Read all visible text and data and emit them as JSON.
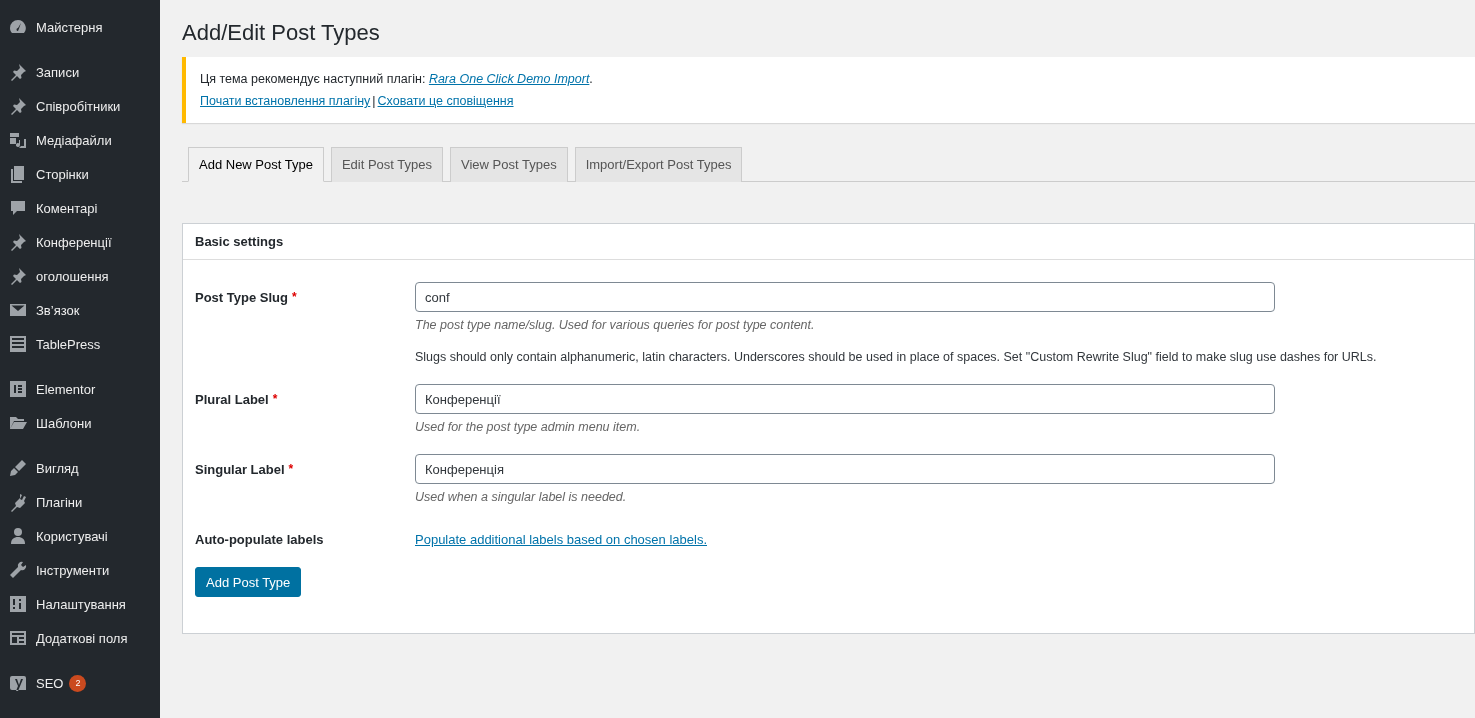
{
  "sidebar": {
    "groups": [
      {
        "items": [
          {
            "label": "Майстерня",
            "kind": "gauge"
          }
        ]
      },
      {
        "items": [
          {
            "label": "Записи",
            "kind": "pin"
          },
          {
            "label": "Співробітники",
            "kind": "pin"
          },
          {
            "label": "Медіафайли",
            "kind": "media"
          },
          {
            "label": "Сторінки",
            "kind": "pages"
          },
          {
            "label": "Коментарі",
            "kind": "comment"
          },
          {
            "label": "Конференції",
            "kind": "pin"
          },
          {
            "label": "оголошення",
            "kind": "pin"
          },
          {
            "label": "Зв’язок",
            "kind": "mail"
          },
          {
            "label": "TablePress",
            "kind": "table"
          }
        ]
      },
      {
        "items": [
          {
            "label": "Elementor",
            "kind": "elementor"
          },
          {
            "label": "Шаблони",
            "kind": "folder"
          }
        ]
      },
      {
        "items": [
          {
            "label": "Вигляд",
            "kind": "brush"
          },
          {
            "label": "Плагіни",
            "kind": "plug"
          },
          {
            "label": "Користувачі",
            "kind": "user"
          },
          {
            "label": "Інструменти",
            "kind": "wrench"
          },
          {
            "label": "Налаштування",
            "kind": "sliders"
          },
          {
            "label": "Додаткові поля",
            "kind": "fields"
          }
        ]
      },
      {
        "items": [
          {
            "label": "SEO",
            "kind": "yoast",
            "badge": "2"
          }
        ]
      }
    ]
  },
  "page_title": "Add/Edit Post Types",
  "notice": {
    "text": "Ця тема рекомендує наступний плагін: ",
    "plugin_link": "Rara One Click Demo Import",
    "after": ".",
    "links": [
      "Почати встановлення плагіну",
      "Сховати це сповіщення"
    ],
    "separator": "|"
  },
  "tabs": [
    {
      "label": "Add New Post Type",
      "selected": true
    },
    {
      "label": "Edit Post Types",
      "selected": false
    },
    {
      "label": "View Post Types",
      "selected": false
    },
    {
      "label": "Import/Export Post Types",
      "selected": false
    }
  ],
  "panel": {
    "title": "Basic settings",
    "rows": [
      {
        "kind": "input",
        "label": "Post Type Slug",
        "required_mark": "*",
        "value": "conf",
        "help": "The post type name/slug. Used for various queries for post type content.",
        "note": "Slugs should only contain alphanumeric, latin characters. Underscores should be used in place of spaces. Set \"Custom Rewrite Slug\" field to make slug use dashes for URLs."
      },
      {
        "kind": "input",
        "label": "Plural Label",
        "required_mark": "*",
        "value": "Конференції",
        "help": "Used for the post type admin menu item."
      },
      {
        "kind": "input",
        "label": "Singular Label",
        "required_mark": "*",
        "value": "Конференція",
        "help": "Used when a singular label is needed."
      },
      {
        "kind": "link",
        "label": "Auto-populate labels",
        "link": "Populate additional labels based on chosen labels."
      }
    ],
    "submit": "Add Post Type"
  }
}
